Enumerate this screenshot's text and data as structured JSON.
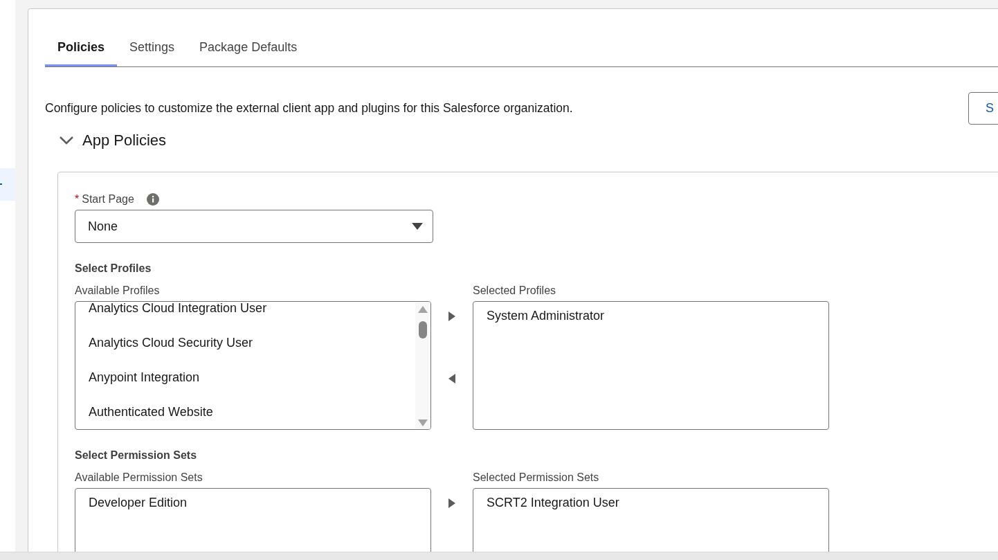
{
  "tabs": [
    {
      "label": "Policies",
      "selected": true
    },
    {
      "label": "Settings",
      "selected": false
    },
    {
      "label": "Package Defaults",
      "selected": false
    }
  ],
  "description": "Configure policies to customize the external client app and plugins for this Salesforce organization.",
  "header_button": {
    "label": "S"
  },
  "section": {
    "title": "App Policies",
    "expanded": true
  },
  "start_page": {
    "required_mark": "*",
    "label": "Start Page",
    "value": "None"
  },
  "dueling_lists": [
    {
      "title": "Select Profiles",
      "available_label": "Available Profiles",
      "available": [
        "Analytics Cloud Integration User",
        "Analytics Cloud Security User",
        "Anypoint Integration",
        "Authenticated Website"
      ],
      "selected_label": "Selected Profiles",
      "selected": [
        "System Administrator"
      ]
    },
    {
      "title": "Select Permission Sets",
      "available_label": "Available Permission Sets",
      "available": [
        "Developer Edition"
      ],
      "selected_label": "Selected Permission Sets",
      "selected": [
        "SCRT2 Integration User"
      ]
    }
  ]
}
